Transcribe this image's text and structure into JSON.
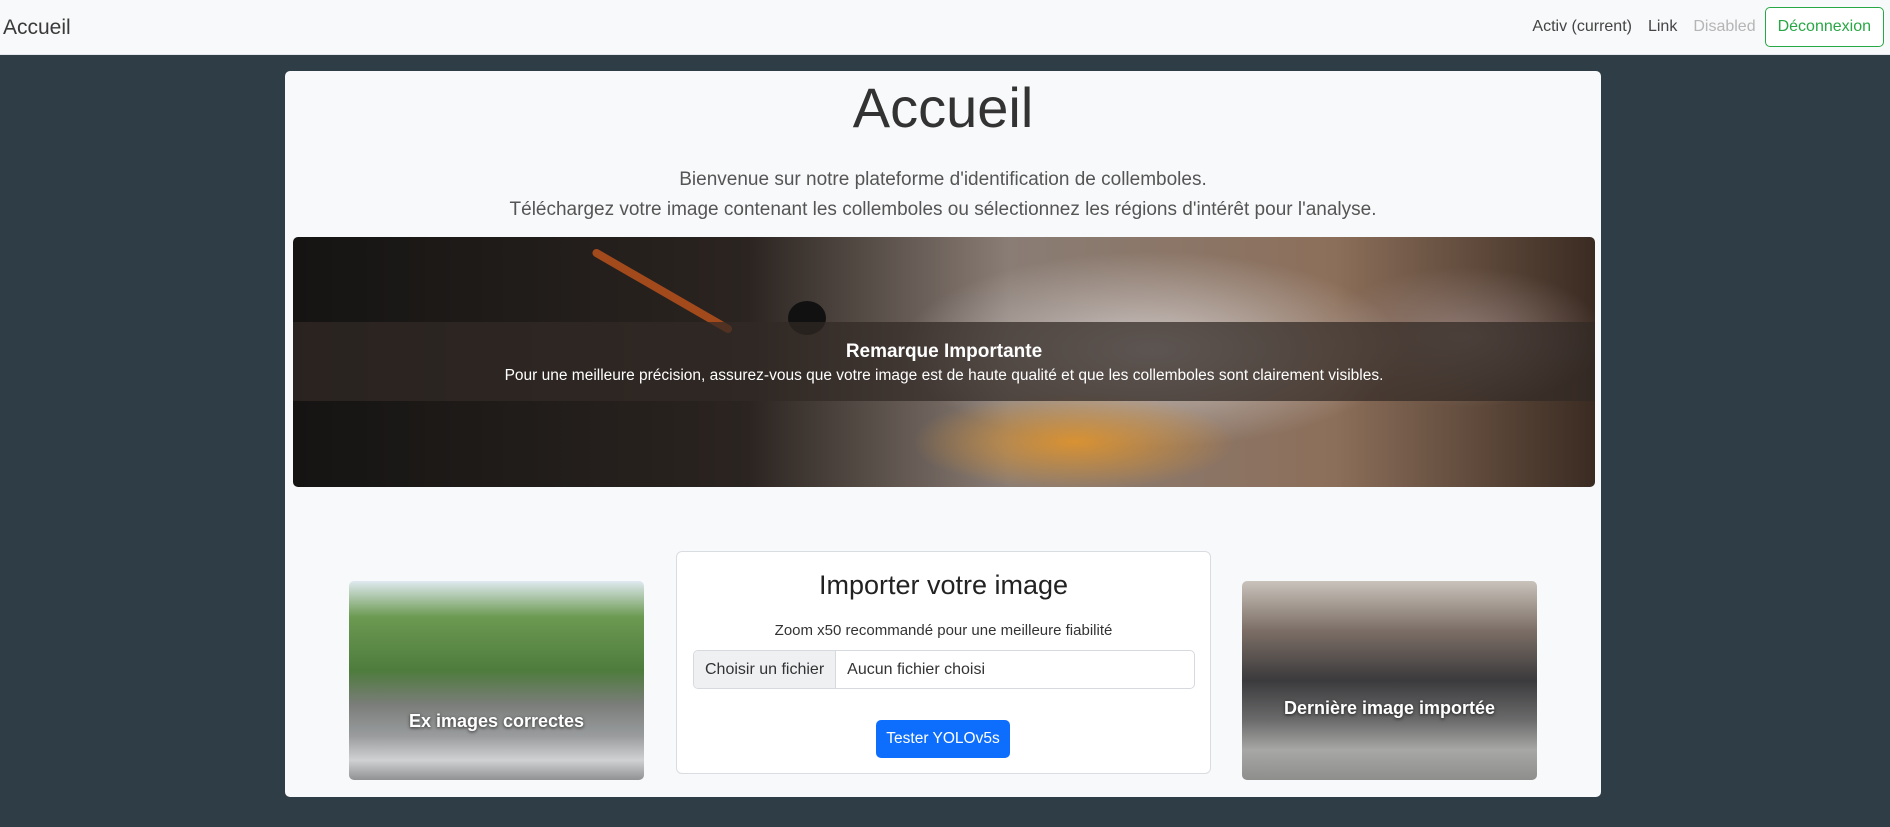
{
  "navbar": {
    "brand": "Accueil",
    "links": [
      {
        "label": "Activ (current)",
        "state": "active"
      },
      {
        "label": "Link",
        "state": "normal"
      },
      {
        "label": "Disabled",
        "state": "disabled"
      }
    ],
    "logout_label": "Déconnexion"
  },
  "main": {
    "title": "Accueil",
    "intro_line1": "Bienvenue sur notre plateforme d'identification de collemboles.",
    "intro_line2": "Téléchargez votre image contenant les collemboles ou sélectionnez les régions d'intérêt pour l'analyse.",
    "banner": {
      "caption_title": "Remarque Importante",
      "caption_text": "Pour une meilleure précision, assurez-vous que votre image est de haute qualité et que les collemboles sont clairement visibles."
    },
    "left_card_label": "Ex images correctes",
    "right_card_label": "Dernière image importée",
    "upload": {
      "title": "Importer votre image",
      "subtitle": "Zoom x50 recommandé pour une meilleure fiabilité",
      "file_button": "Choisir un fichier",
      "file_status": "Aucun fichier choisi",
      "submit_label": "Tester YOLOv5s"
    }
  },
  "colors": {
    "background": "#2f3e46",
    "primary": "#0d6efd",
    "success": "#28a745"
  }
}
